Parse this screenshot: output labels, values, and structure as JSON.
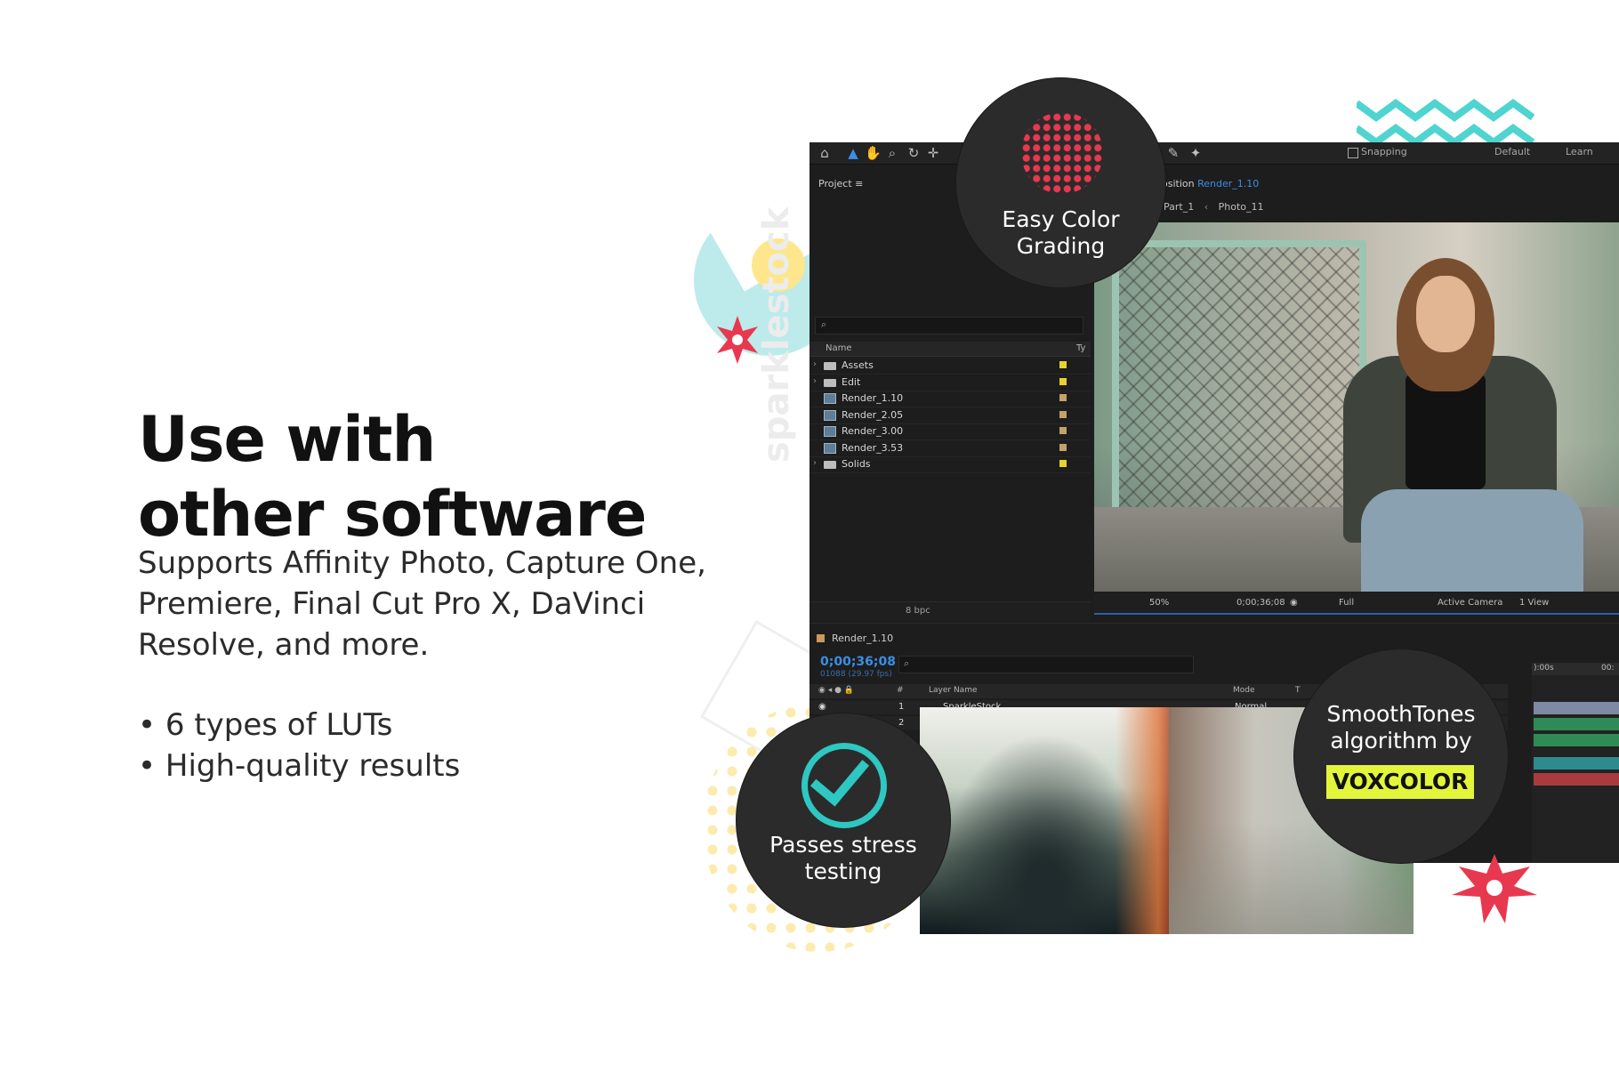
{
  "headline": {
    "line1": "Use with",
    "line2": "other software"
  },
  "description": "Supports Affinity Photo, Capture One, Premiere, Final Cut Pro X, DaVinci Resolve, and more.",
  "bullets": [
    "6 types of LUTs",
    "High-quality results"
  ],
  "watermark": "sparklestock",
  "badges": {
    "grading": "Easy Color Grading",
    "stress": "Passes stress testing",
    "smooth": "SmoothTones algorithm by",
    "brand": "VOXCOLOR"
  },
  "app": {
    "toolbar": {
      "snapping": "Snapping",
      "workspace_default": "Default",
      "workspace_learn": "Learn"
    },
    "project": {
      "title": "Project",
      "menu_icon": "≡",
      "search_icon": "⌕",
      "col_name": "Name",
      "col_type": "Ty",
      "items": [
        {
          "label": "Assets",
          "kind": "folder",
          "tag": "#e8d22e"
        },
        {
          "label": "Edit",
          "kind": "folder",
          "tag": "#e8d22e"
        },
        {
          "label": "Render_1.10",
          "kind": "comp",
          "tag": "#c4a06d"
        },
        {
          "label": "Render_2.05",
          "kind": "comp",
          "tag": "#c4a06d"
        },
        {
          "label": "Render_3.00",
          "kind": "comp",
          "tag": "#c4a06d"
        },
        {
          "label": "Render_3.53",
          "kind": "comp",
          "tag": "#c4a06d"
        },
        {
          "label": "Solids",
          "kind": "folder",
          "tag": "#e8d22e"
        }
      ],
      "bpc": "8 bpc"
    },
    "composition": {
      "title_prefix": "osition",
      "title_name": "Render_1.10",
      "crumbs": [
        "Part_1",
        "Photo_11"
      ]
    },
    "viewer_bar": {
      "zoom": "50%",
      "timecode": "0;00;36;08",
      "resolution": "Full",
      "camera": "Active Camera",
      "views": "1 View"
    },
    "timeline": {
      "tab": "Render_1.10",
      "time": "0;00;36;08",
      "fps": "01088 (29.97 fps)",
      "header_num": "#",
      "header_layer": "Layer Name",
      "header_mode": "Mode",
      "header_t": "T",
      "row_num1": "1",
      "row_num2": "2",
      "row_layer": "SparkleStock",
      "row_mode": "Normal",
      "ruler_start": "):00s",
      "ruler_end": "00:"
    }
  },
  "colors": {
    "accent_blue": "#3a8ee6",
    "teal": "#2ec7c2",
    "red": "#e8384f",
    "vox_yellow": "#e3f53b"
  }
}
